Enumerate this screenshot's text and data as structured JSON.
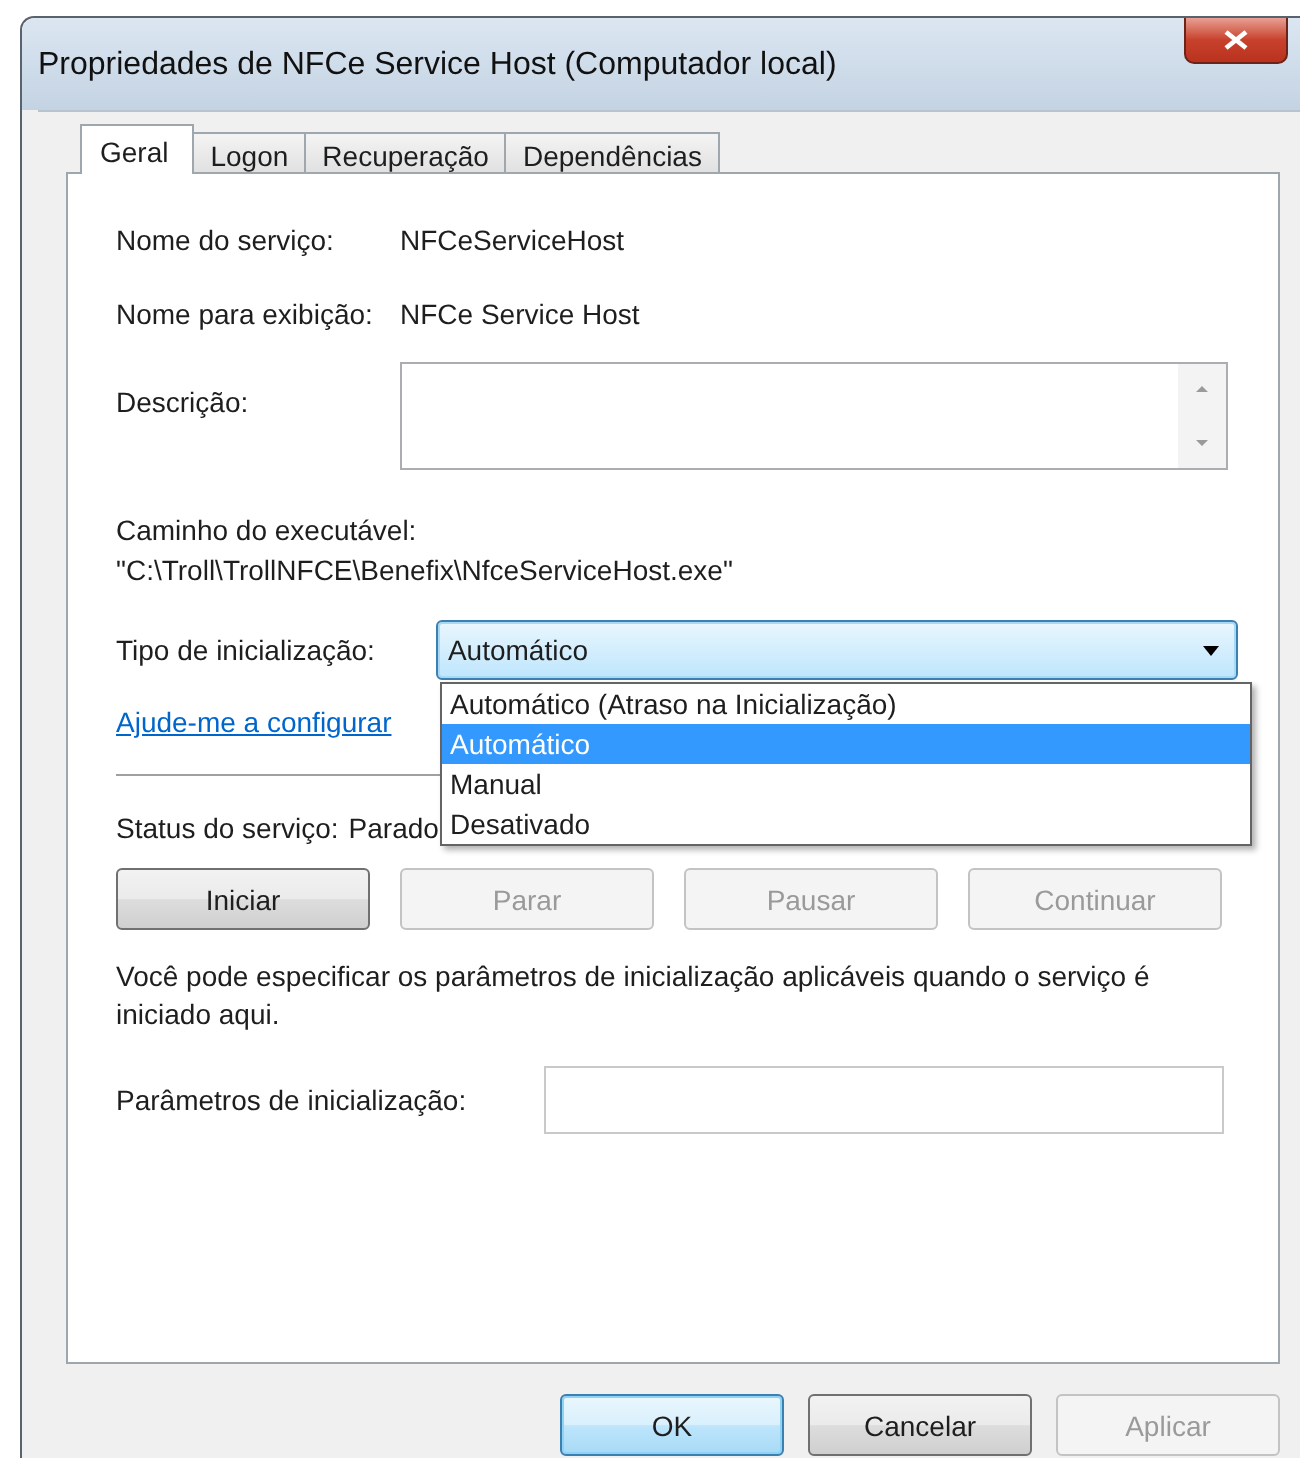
{
  "window": {
    "title": "Propriedades de NFCe Service Host (Computador local)"
  },
  "tabs": [
    {
      "label": "Geral",
      "selected": true
    },
    {
      "label": "Logon",
      "selected": false
    },
    {
      "label": "Recuperação",
      "selected": false
    },
    {
      "label": "Dependências",
      "selected": false
    }
  ],
  "fields": [
    {
      "label": "Nome do serviço:",
      "value": "NFCeServiceHost"
    },
    {
      "label": "Nome para exibição:",
      "value": "NFCe Service Host"
    }
  ],
  "description": {
    "label": "Descrição:"
  },
  "executable": {
    "label": "Caminho do executável:",
    "value": "\"C:\\Troll\\TrollNFCE\\Benefix\\NfceServiceHost.exe\""
  },
  "startup_type": {
    "label": "Tipo de inicialização:",
    "value": "Automático",
    "expanded": true,
    "options": [
      {
        "label": "Automático (Atraso na Inicialização)",
        "selected": false
      },
      {
        "label": "Automático",
        "selected": true
      },
      {
        "label": "Manual",
        "selected": false
      },
      {
        "label": "Desativado",
        "selected": false
      }
    ]
  },
  "help_link": "Ajude-me a configurar",
  "status": {
    "label": "Status do serviço:",
    "value": "Parado"
  },
  "service_buttons": [
    {
      "label": "Iniciar",
      "disabled": false
    },
    {
      "label": "Parar",
      "disabled": true
    },
    {
      "label": "Pausar",
      "disabled": true
    },
    {
      "label": "Continuar",
      "disabled": true
    }
  ],
  "hint": "Você pode especificar os parâmetros de inicialização aplicáveis quando o serviço é iniciado aqui.",
  "parameters": {
    "label": "Parâmetros de inicialização:"
  },
  "dialog_buttons": [
    {
      "label": "OK",
      "disabled": false,
      "default": true
    },
    {
      "label": "Cancelar",
      "disabled": false,
      "default": false
    },
    {
      "label": "Aplicar",
      "disabled": true,
      "default": false
    }
  ]
}
